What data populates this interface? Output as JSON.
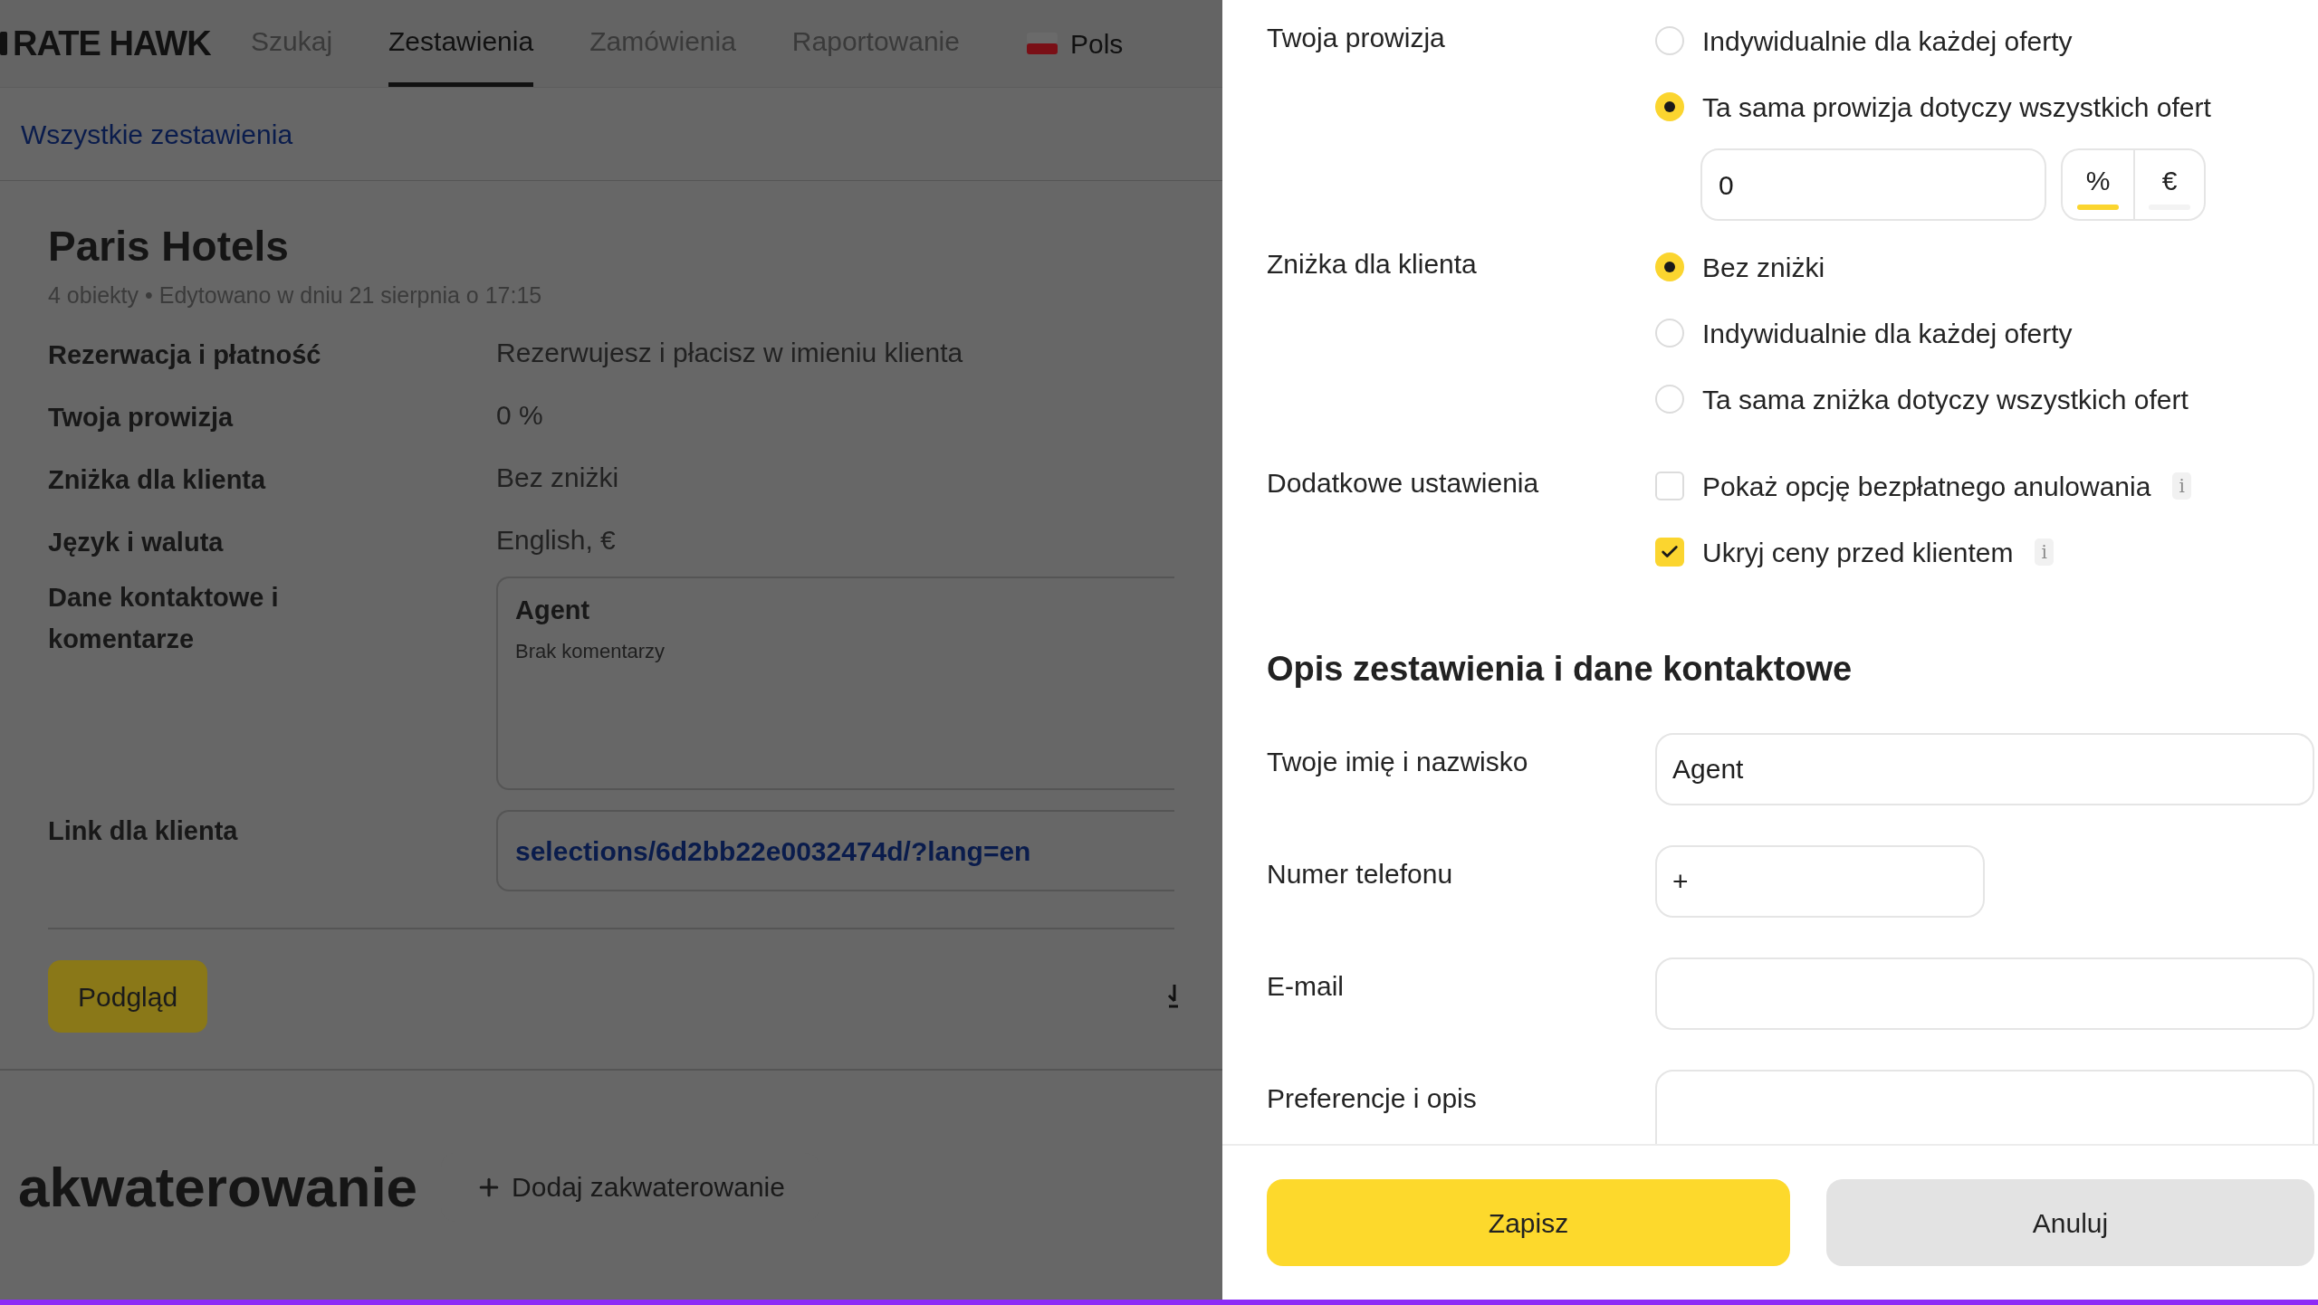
{
  "header": {
    "logo": "RATE HAWK",
    "tabs": [
      {
        "label": "Szukaj",
        "selected": false
      },
      {
        "label": "Zestawienia",
        "selected": true
      },
      {
        "label": "Zamówienia",
        "selected": false
      },
      {
        "label": "Raportowanie",
        "selected": false
      }
    ],
    "language": "Pols"
  },
  "breadcrumb": "Wszystkie zestawienia",
  "selection": {
    "title": "Paris Hotels",
    "meta": "4 obiekty • Edytowano w dniu 21 sierpnia o 17:15",
    "rows": [
      {
        "kind": "text",
        "label": "Rezerwacja i płatność",
        "value": "Rezerwujesz i płacisz w imieniu klienta"
      },
      {
        "kind": "text",
        "label": "Twoja prowizja",
        "value": "0 %"
      },
      {
        "kind": "text",
        "label": "Zniżka dla klienta",
        "value": "Bez zniżki"
      },
      {
        "kind": "text",
        "label": "Język i waluta",
        "value": "English, €"
      },
      {
        "kind": "contact",
        "label": "Dane kontaktowe i komentarze",
        "name": "Agent",
        "comment": "Brak komentarzy"
      },
      {
        "kind": "link",
        "label": "Link dla klienta",
        "value": "selections/6d2bb22e0032474d/?lang=en"
      }
    ],
    "preview_button": "Podgląd"
  },
  "accommodation": {
    "title": "akwaterowanie",
    "add_button": "Dodaj zakwaterowanie"
  },
  "drawer": {
    "sections": [
      {
        "label": "Twoja prowizja",
        "options": [
          {
            "kind": "radio",
            "label": "Indywidualnie dla każdej oferty",
            "selected": false
          },
          {
            "kind": "radio",
            "label": "Ta sama prowizja dotyczy wszystkich ofert",
            "selected": true
          }
        ],
        "amount": {
          "value": "0",
          "units": [
            {
              "label": "%",
              "selected": true
            },
            {
              "label": "€",
              "selected": false
            }
          ]
        }
      },
      {
        "label": "Zniżka dla klienta",
        "options": [
          {
            "kind": "radio",
            "label": "Bez zniżki",
            "selected": true
          },
          {
            "kind": "radio",
            "label": "Indywidualnie dla każdej oferty",
            "selected": false
          },
          {
            "kind": "radio",
            "label": "Ta sama zniżka dotyczy wszystkich ofert",
            "selected": false
          }
        ]
      },
      {
        "label": "Dodatkowe ustawienia",
        "options": [
          {
            "kind": "checkbox",
            "label": "Pokaż opcję bezpłatnego anulowania",
            "checked": false,
            "info": "i"
          },
          {
            "kind": "checkbox",
            "label": "Ukryj ceny przed klientem",
            "checked": true,
            "info": "i"
          }
        ]
      }
    ],
    "contact_heading": "Opis zestawienia i dane kontaktowe",
    "fields": [
      {
        "kind": "full",
        "label": "Twoje imię i nazwisko",
        "value": "Agent"
      },
      {
        "kind": "short",
        "label": "Numer telefonu",
        "value": "+"
      },
      {
        "kind": "full",
        "label": "E-mail"
      },
      {
        "kind": "textarea",
        "label": "Preferencje i opis"
      }
    ],
    "buttons": [
      {
        "kind": "primary",
        "label": "Zapisz"
      },
      {
        "kind": "secondary",
        "label": "Anuluj"
      }
    ]
  }
}
